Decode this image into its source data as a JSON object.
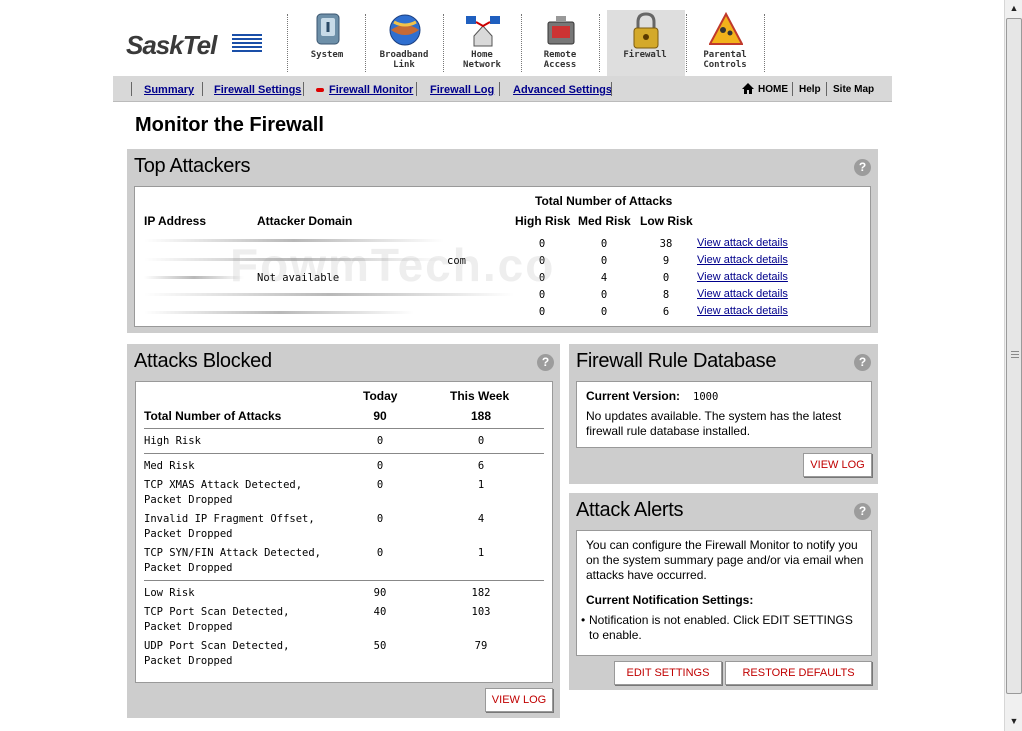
{
  "brand": {
    "logo_text": "SaskTel"
  },
  "nav": {
    "tabs": [
      {
        "label": "System",
        "icon": "system-icon"
      },
      {
        "label": "Broadband\nLink",
        "icon": "globe-icon"
      },
      {
        "label": "Home\nNetwork",
        "icon": "network-icon"
      },
      {
        "label": "Remote\nAccess",
        "icon": "remote-icon"
      },
      {
        "label": "Firewall",
        "icon": "lock-icon",
        "active": true
      },
      {
        "label": "Parental\nControls",
        "icon": "warning-icon"
      }
    ]
  },
  "subnav": {
    "links": [
      "Summary",
      "Firewall Settings",
      "Firewall Monitor",
      "Firewall Log",
      "Advanced Settings"
    ],
    "home": "HOME",
    "help": "Help",
    "sitemap": "Site Map"
  },
  "page": {
    "title": "Monitor the Firewall"
  },
  "watermark": "FowmTech.co",
  "top_attackers": {
    "title": "Top Attackers",
    "help": "?",
    "total_header": "Total Number of Attacks",
    "columns": [
      "IP Address",
      "Attacker Domain",
      "High Risk",
      "Med Risk",
      "Low Risk"
    ],
    "rows": [
      {
        "domain": "",
        "high": "0",
        "med": "0",
        "low": "38",
        "link": "View attack details"
      },
      {
        "domain": "com",
        "high": "0",
        "med": "0",
        "low": "9",
        "link": "View attack details"
      },
      {
        "domain": "Not available",
        "high": "0",
        "med": "4",
        "low": "0",
        "link": "View attack details"
      },
      {
        "domain": "",
        "high": "0",
        "med": "0",
        "low": "8",
        "link": "View attack details"
      },
      {
        "domain": "",
        "high": "0",
        "med": "0",
        "low": "6",
        "link": "View attack details"
      }
    ]
  },
  "attacks_blocked": {
    "title": "Attacks Blocked",
    "help": "?",
    "col_today": "Today",
    "col_week": "This Week",
    "total_label": "Total Number of Attacks",
    "total_today": "90",
    "total_week": "188",
    "high": {
      "label": "High Risk",
      "today": "0",
      "week": "0"
    },
    "med": {
      "label": "Med Risk",
      "today": "0",
      "week": "6"
    },
    "med_items": [
      {
        "label1": "TCP XMAS Attack Detected,",
        "label2": "Packet Dropped",
        "today": "0",
        "week": "1"
      },
      {
        "label1": "Invalid IP Fragment Offset,",
        "label2": "Packet Dropped",
        "today": "0",
        "week": "4"
      },
      {
        "label1": "TCP SYN/FIN Attack Detected,",
        "label2": "Packet Dropped",
        "today": "0",
        "week": "1"
      }
    ],
    "low": {
      "label": "Low Risk",
      "today": "90",
      "week": "182"
    },
    "low_items": [
      {
        "label1": "TCP Port Scan Detected,",
        "label2": "Packet Dropped",
        "today": "40",
        "week": "103"
      },
      {
        "label1": "UDP Port Scan Detected,",
        "label2": "Packet Dropped",
        "today": "50",
        "week": "79"
      }
    ],
    "button": "VIEW LOG"
  },
  "rule_db": {
    "title": "Firewall Rule Database",
    "help": "?",
    "version_label": "Current Version:",
    "version_value": "1000",
    "message": "No updates available. The system has the latest firewall rule database installed.",
    "button": "VIEW LOG"
  },
  "alerts": {
    "title": "Attack Alerts",
    "help": "?",
    "description": "You can configure the Firewall Monitor to notify you on the system summary page and/or via email when attacks have occurred.",
    "settings_label": "Current Notification Settings:",
    "setting_text": "Notification is not enabled. Click EDIT SETTINGS to enable.",
    "btn_edit": "EDIT SETTINGS",
    "btn_restore": "RESTORE DEFAULTS"
  },
  "colors": {
    "link": "#00008b",
    "panel": "#cdcdcd",
    "button_text": "#c00000",
    "active_tab": "#dedede"
  }
}
